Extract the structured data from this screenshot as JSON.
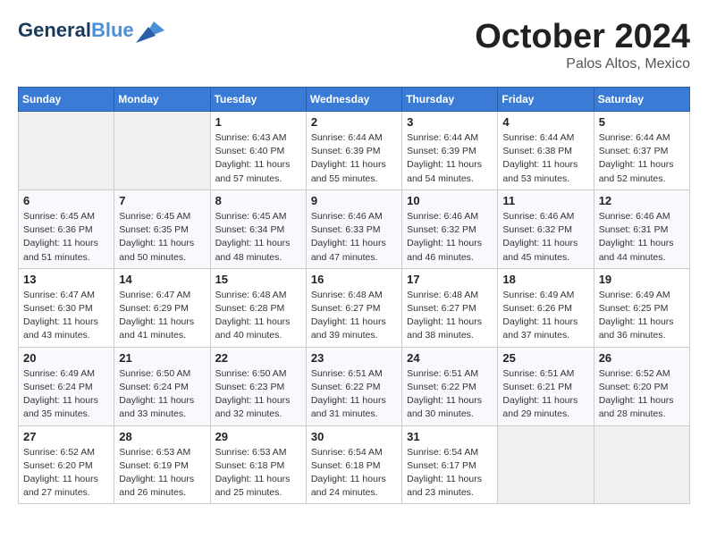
{
  "header": {
    "logo_line1": "General",
    "logo_line2": "Blue",
    "month": "October 2024",
    "location": "Palos Altos, Mexico"
  },
  "weekdays": [
    "Sunday",
    "Monday",
    "Tuesday",
    "Wednesday",
    "Thursday",
    "Friday",
    "Saturday"
  ],
  "weeks": [
    [
      {
        "day": "",
        "info": ""
      },
      {
        "day": "",
        "info": ""
      },
      {
        "day": "1",
        "info": "Sunrise: 6:43 AM\nSunset: 6:40 PM\nDaylight: 11 hours and 57 minutes."
      },
      {
        "day": "2",
        "info": "Sunrise: 6:44 AM\nSunset: 6:39 PM\nDaylight: 11 hours and 55 minutes."
      },
      {
        "day": "3",
        "info": "Sunrise: 6:44 AM\nSunset: 6:39 PM\nDaylight: 11 hours and 54 minutes."
      },
      {
        "day": "4",
        "info": "Sunrise: 6:44 AM\nSunset: 6:38 PM\nDaylight: 11 hours and 53 minutes."
      },
      {
        "day": "5",
        "info": "Sunrise: 6:44 AM\nSunset: 6:37 PM\nDaylight: 11 hours and 52 minutes."
      }
    ],
    [
      {
        "day": "6",
        "info": "Sunrise: 6:45 AM\nSunset: 6:36 PM\nDaylight: 11 hours and 51 minutes."
      },
      {
        "day": "7",
        "info": "Sunrise: 6:45 AM\nSunset: 6:35 PM\nDaylight: 11 hours and 50 minutes."
      },
      {
        "day": "8",
        "info": "Sunrise: 6:45 AM\nSunset: 6:34 PM\nDaylight: 11 hours and 48 minutes."
      },
      {
        "day": "9",
        "info": "Sunrise: 6:46 AM\nSunset: 6:33 PM\nDaylight: 11 hours and 47 minutes."
      },
      {
        "day": "10",
        "info": "Sunrise: 6:46 AM\nSunset: 6:32 PM\nDaylight: 11 hours and 46 minutes."
      },
      {
        "day": "11",
        "info": "Sunrise: 6:46 AM\nSunset: 6:32 PM\nDaylight: 11 hours and 45 minutes."
      },
      {
        "day": "12",
        "info": "Sunrise: 6:46 AM\nSunset: 6:31 PM\nDaylight: 11 hours and 44 minutes."
      }
    ],
    [
      {
        "day": "13",
        "info": "Sunrise: 6:47 AM\nSunset: 6:30 PM\nDaylight: 11 hours and 43 minutes."
      },
      {
        "day": "14",
        "info": "Sunrise: 6:47 AM\nSunset: 6:29 PM\nDaylight: 11 hours and 41 minutes."
      },
      {
        "day": "15",
        "info": "Sunrise: 6:48 AM\nSunset: 6:28 PM\nDaylight: 11 hours and 40 minutes."
      },
      {
        "day": "16",
        "info": "Sunrise: 6:48 AM\nSunset: 6:27 PM\nDaylight: 11 hours and 39 minutes."
      },
      {
        "day": "17",
        "info": "Sunrise: 6:48 AM\nSunset: 6:27 PM\nDaylight: 11 hours and 38 minutes."
      },
      {
        "day": "18",
        "info": "Sunrise: 6:49 AM\nSunset: 6:26 PM\nDaylight: 11 hours and 37 minutes."
      },
      {
        "day": "19",
        "info": "Sunrise: 6:49 AM\nSunset: 6:25 PM\nDaylight: 11 hours and 36 minutes."
      }
    ],
    [
      {
        "day": "20",
        "info": "Sunrise: 6:49 AM\nSunset: 6:24 PM\nDaylight: 11 hours and 35 minutes."
      },
      {
        "day": "21",
        "info": "Sunrise: 6:50 AM\nSunset: 6:24 PM\nDaylight: 11 hours and 33 minutes."
      },
      {
        "day": "22",
        "info": "Sunrise: 6:50 AM\nSunset: 6:23 PM\nDaylight: 11 hours and 32 minutes."
      },
      {
        "day": "23",
        "info": "Sunrise: 6:51 AM\nSunset: 6:22 PM\nDaylight: 11 hours and 31 minutes."
      },
      {
        "day": "24",
        "info": "Sunrise: 6:51 AM\nSunset: 6:22 PM\nDaylight: 11 hours and 30 minutes."
      },
      {
        "day": "25",
        "info": "Sunrise: 6:51 AM\nSunset: 6:21 PM\nDaylight: 11 hours and 29 minutes."
      },
      {
        "day": "26",
        "info": "Sunrise: 6:52 AM\nSunset: 6:20 PM\nDaylight: 11 hours and 28 minutes."
      }
    ],
    [
      {
        "day": "27",
        "info": "Sunrise: 6:52 AM\nSunset: 6:20 PM\nDaylight: 11 hours and 27 minutes."
      },
      {
        "day": "28",
        "info": "Sunrise: 6:53 AM\nSunset: 6:19 PM\nDaylight: 11 hours and 26 minutes."
      },
      {
        "day": "29",
        "info": "Sunrise: 6:53 AM\nSunset: 6:18 PM\nDaylight: 11 hours and 25 minutes."
      },
      {
        "day": "30",
        "info": "Sunrise: 6:54 AM\nSunset: 6:18 PM\nDaylight: 11 hours and 24 minutes."
      },
      {
        "day": "31",
        "info": "Sunrise: 6:54 AM\nSunset: 6:17 PM\nDaylight: 11 hours and 23 minutes."
      },
      {
        "day": "",
        "info": ""
      },
      {
        "day": "",
        "info": ""
      }
    ]
  ]
}
